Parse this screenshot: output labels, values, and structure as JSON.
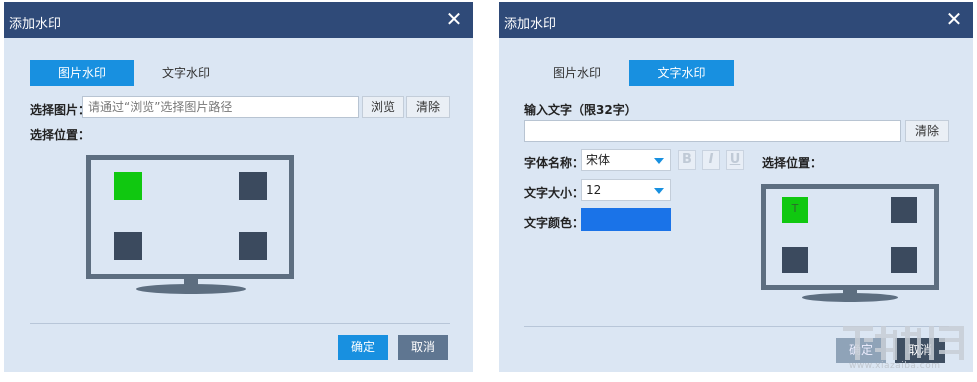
{
  "left_dialog": {
    "title": "添加水印",
    "close_glyph": "✕",
    "tabs": [
      {
        "label": "图片水印",
        "active": true
      },
      {
        "label": "文字水印",
        "active": false
      }
    ],
    "image_label": "选择图片：",
    "image_placeholder": "请通过“浏览”选择图片路径",
    "browse_button": "浏览",
    "clear_button": "清除",
    "position_label": "选择位置：",
    "selected_position": "top-left",
    "ok_button": "确定",
    "cancel_button": "取消"
  },
  "right_dialog": {
    "title": "添加水印",
    "close_glyph": "✕",
    "tabs": [
      {
        "label": "图片水印",
        "active": false
      },
      {
        "label": "文字水印",
        "active": true
      }
    ],
    "input_label": "输入文字（限32字）",
    "text_value": "",
    "clear_button": "清除",
    "font_name_label": "字体名称：",
    "font_name_value": "宋体",
    "font_size_label": "文字大小：",
    "font_size_value": "12",
    "bold_glyph": "B",
    "italic_glyph": "I",
    "underline_glyph": "U",
    "color_label": "文字颜色：",
    "text_color": "#1a73e8",
    "position_label": "选择位置：",
    "selected_position": "top-left",
    "selected_position_glyph": "T",
    "ok_button": "确定",
    "cancel_button": "取消"
  },
  "colors": {
    "title_bar": "#2f4a78",
    "tab_active": "#1890e0",
    "selected_position": "#10c810",
    "position_box": "#3b4a5e",
    "monitor": "#5d6e80"
  },
  "watermark": {
    "site": "www.xiazaiba.com"
  }
}
